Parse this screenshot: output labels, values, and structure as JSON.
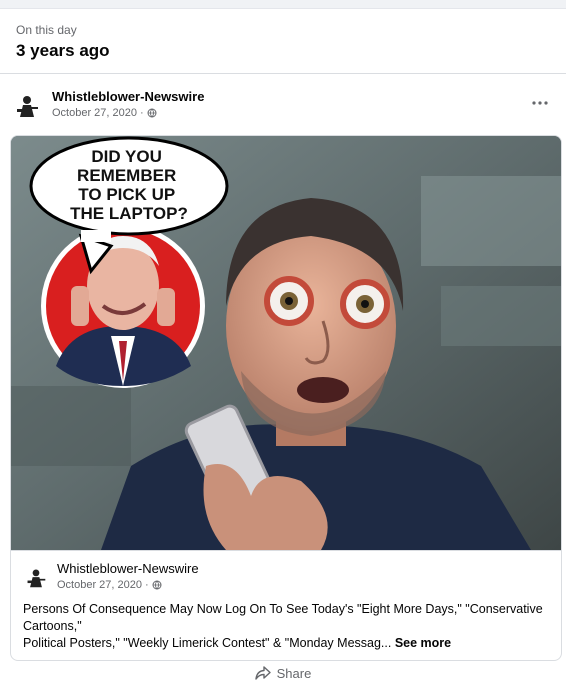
{
  "memory": {
    "label": "On this day",
    "title": "3 years ago"
  },
  "post": {
    "author": "Whistleblower-Newswire",
    "date": "October 27, 2020 ·",
    "privacy_icon": "globe-icon",
    "more_icon": "more-horizontal-icon"
  },
  "meme": {
    "bubble_lines": [
      "DID YOU",
      "REMEMBER",
      "TO PICK UP",
      "THE LAPTOP?"
    ]
  },
  "shared": {
    "author": "Whistleblower-Newswire",
    "date": "October 27, 2020 ·",
    "text_line1": "Persons Of Consequence May Now Log On To See Today's \"Eight More Days,\" \"Conservative Cartoons,\"",
    "text_line2": "Political Posters,\" \"Weekly Limerick Contest\" & \"Monday Messag...",
    "see_more": "See more"
  },
  "actions": {
    "share_label": "Share",
    "share_icon": "share-arrow-icon"
  },
  "colors": {
    "accent_red": "#d91f1f",
    "muted_text": "#65676b",
    "border": "#dadde1"
  }
}
